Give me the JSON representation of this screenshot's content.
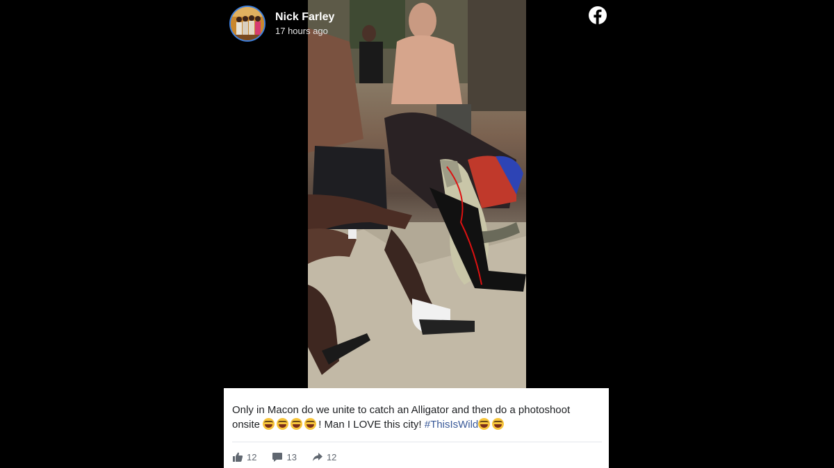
{
  "post": {
    "author": "Nick Farley",
    "time": "17 hours ago",
    "caption_part1": "Only in Macon do we unite to catch an Alligator and then do a photoshoot onsite ",
    "caption_part2": "! Man I LOVE this city! ",
    "hashtag": "#ThisIsWild",
    "emojis_before": 4,
    "emojis_after": 2,
    "emoji_icon": "laughing-tears-emoji"
  },
  "stats": {
    "likes": "12",
    "comments": "13",
    "shares": "12"
  },
  "icons": {
    "brand": "facebook-icon",
    "like": "thumbs-up-icon",
    "comment": "comment-icon",
    "share": "share-arrow-icon"
  },
  "colors": {
    "facebook_logo": "#ffffff",
    "hashtag": "#385898",
    "avatar_ring": "#3b7fe0",
    "card_bg": "#ffffff",
    "stats_text": "#606770"
  }
}
